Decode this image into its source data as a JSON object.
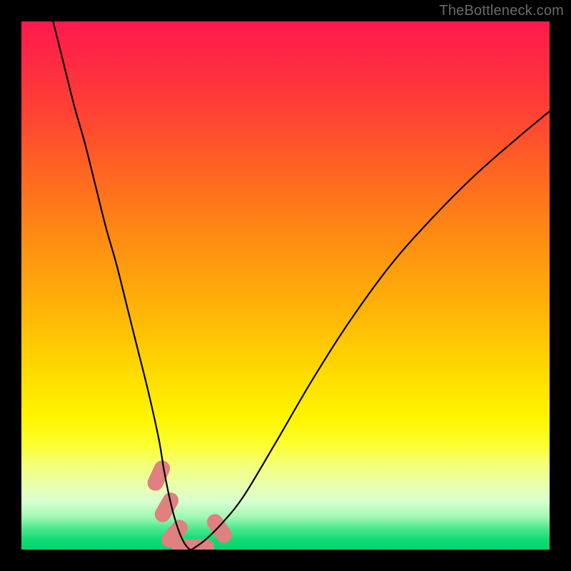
{
  "watermark": "TheBottleneck.com",
  "chart_data": {
    "type": "line",
    "title": "",
    "xlabel": "",
    "ylabel": "",
    "xlim": [
      0,
      100
    ],
    "ylim": [
      0,
      100
    ],
    "grid": false,
    "series": [
      {
        "name": "curve",
        "color": "#000000",
        "x": [
          6,
          8,
          10,
          12,
          14,
          16,
          18,
          20,
          22,
          24,
          26,
          27,
          28,
          29,
          30,
          31,
          32,
          33,
          35,
          38,
          42,
          48,
          55,
          62,
          70,
          78,
          86,
          94,
          100
        ],
        "y": [
          100,
          92,
          84,
          77,
          69,
          61,
          54,
          46,
          38,
          30,
          21,
          15,
          10,
          6,
          3,
          1,
          0,
          0.5,
          2,
          5,
          10,
          20,
          32,
          43,
          54,
          63,
          71,
          78,
          83
        ]
      }
    ],
    "markers": [
      {
        "shape": "rounded-rect",
        "color": "#e08080",
        "x": 26.0,
        "y": 14,
        "w": 3,
        "h": 6,
        "rot": 25
      },
      {
        "shape": "rounded-rect",
        "color": "#e08080",
        "x": 27.5,
        "y": 8,
        "w": 3,
        "h": 6,
        "rot": 30
      },
      {
        "shape": "rounded-rect",
        "color": "#e08080",
        "x": 29.0,
        "y": 3,
        "w": 3,
        "h": 6,
        "rot": 40
      },
      {
        "shape": "rounded-rect",
        "color": "#e08080",
        "x": 31.0,
        "y": 0.5,
        "w": 5,
        "h": 3,
        "rot": 0
      },
      {
        "shape": "rounded-rect",
        "color": "#e08080",
        "x": 34.0,
        "y": 0.5,
        "w": 5,
        "h": 3,
        "rot": 0
      },
      {
        "shape": "rounded-rect",
        "color": "#e08080",
        "x": 37.5,
        "y": 4,
        "w": 3,
        "h": 6,
        "rot": -35
      }
    ],
    "gradient_stops": [
      {
        "pos": 0.0,
        "color": "#ff1a4d"
      },
      {
        "pos": 0.3,
        "color": "#ff6a1f"
      },
      {
        "pos": 0.66,
        "color": "#ffd900"
      },
      {
        "pos": 0.8,
        "color": "#fcff2e"
      },
      {
        "pos": 0.94,
        "color": "#9cf7b0"
      },
      {
        "pos": 1.0,
        "color": "#00d56d"
      }
    ]
  }
}
